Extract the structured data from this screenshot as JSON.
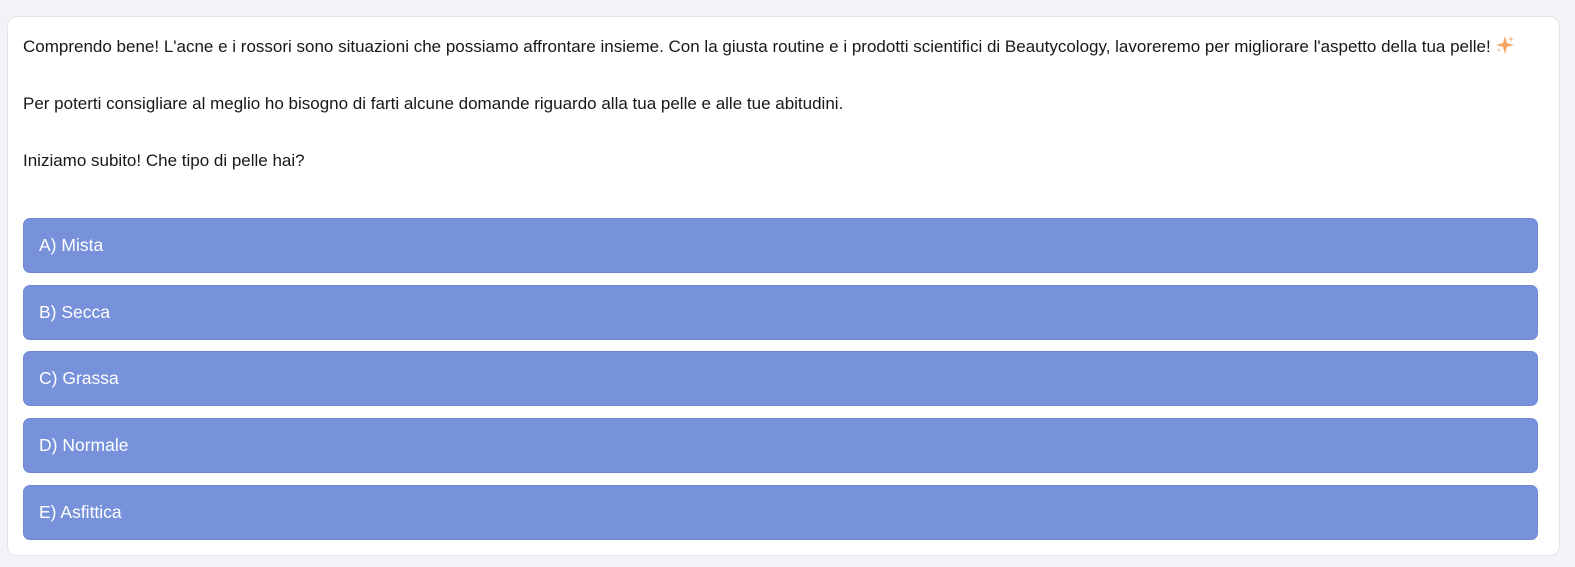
{
  "message": {
    "paragraph_1": "Comprendo bene! L'acne e i rossori sono situazioni che possiamo affrontare insieme. Con la giusta routine e i prodotti scientifici di Beautycology, lavoreremo per migliorare l'aspetto della tua pelle!",
    "paragraph_1_icon": "sparkles-icon",
    "paragraph_2": "Per poterti consigliare al meglio ho bisogno di farti alcune domande riguardo alla tua pelle e alle tue abitudini.",
    "paragraph_3": "Iniziamo subito! Che tipo di pelle hai?"
  },
  "options": [
    {
      "label": "A) Mista"
    },
    {
      "label": "B) Secca"
    },
    {
      "label": "C) Grassa"
    },
    {
      "label": "D) Normale"
    },
    {
      "label": "E) Asfittica"
    }
  ],
  "colors": {
    "background": "#f2f3f6",
    "card": "#ffffff",
    "option_button": "#7891db",
    "text": "#16181c",
    "sparkle": "#f4a866"
  }
}
